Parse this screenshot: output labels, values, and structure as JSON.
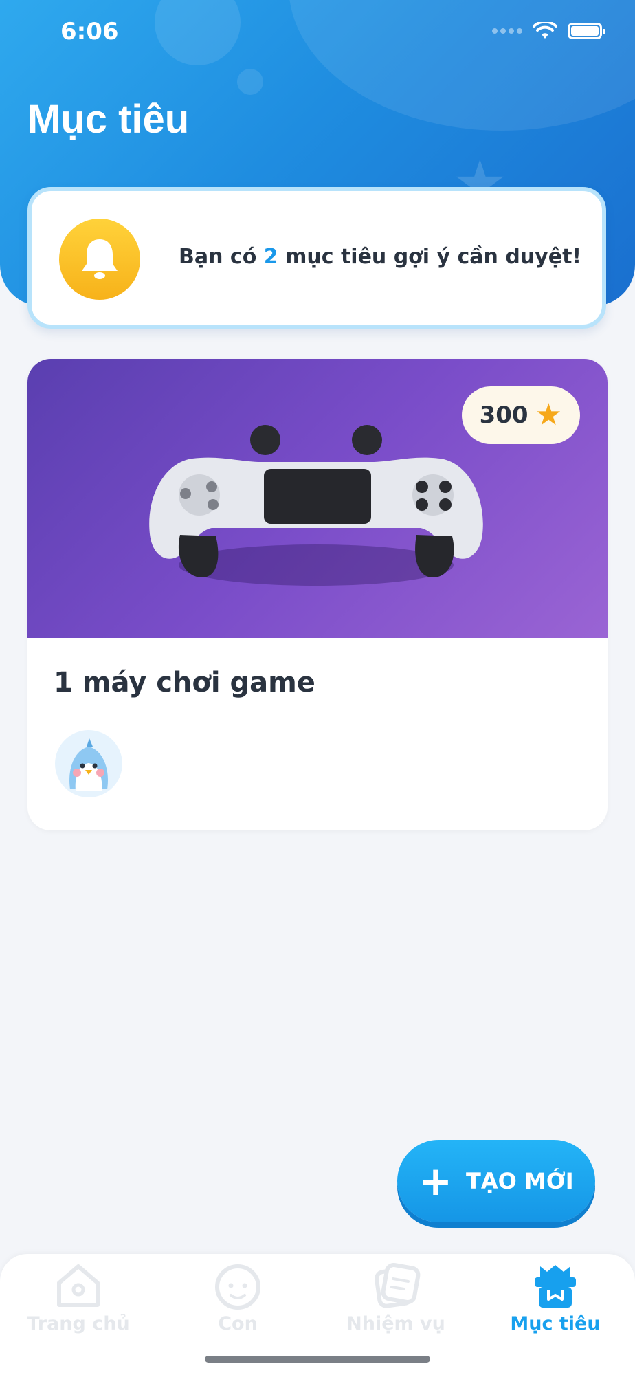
{
  "status_bar": {
    "time": "6:06"
  },
  "header": {
    "title": "Mục tiêu"
  },
  "notice": {
    "prefix": "Bạn có",
    "count": "2",
    "suffix": "mục tiêu gợi ý cần duyệt!",
    "icon": "bell-icon"
  },
  "goal_card": {
    "points": "300",
    "points_icon": "star-icon",
    "title": "1 máy chơi game",
    "image": "game-controller-image",
    "avatar": "penguin-avatar"
  },
  "fab": {
    "label": "TẠO MỚI",
    "icon": "plus-icon"
  },
  "tabs": [
    {
      "label": "Trang chủ",
      "icon": "home-icon",
      "active": false
    },
    {
      "label": "Con",
      "icon": "child-face-icon",
      "active": false
    },
    {
      "label": "Nhiệm vụ",
      "icon": "task-icon",
      "active": false
    },
    {
      "label": "Mục tiêu",
      "icon": "gift-icon",
      "active": true
    }
  ],
  "colors": {
    "accent": "#17a0ee",
    "header_gradient_start": "#2fa9ee",
    "header_gradient_end": "#1a6fcf",
    "bell": "#f7b21a",
    "card_image": "#7a4dc9"
  }
}
